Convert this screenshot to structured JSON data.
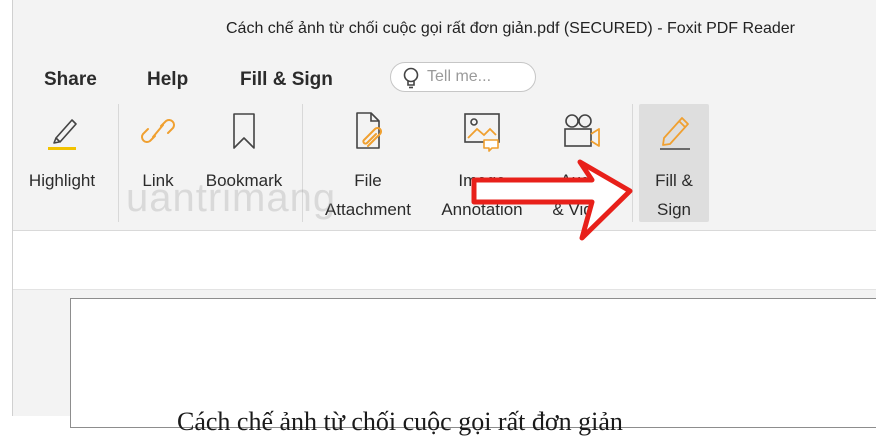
{
  "window": {
    "title": "Cách chế ảnh từ chối cuộc gọi rất đơn giản.pdf (SECURED) - Foxit PDF Reader"
  },
  "menu": {
    "tabs": [
      {
        "label": "Share"
      },
      {
        "label": "Help"
      },
      {
        "label": "Fill & Sign"
      }
    ],
    "tell_me": {
      "placeholder": "Tell me..."
    }
  },
  "toolbar": {
    "highlight": {
      "line1": "Highlight",
      "line2": "",
      "accent": "#f2c200"
    },
    "link": {
      "line1": "Link",
      "line2": "",
      "accent": "#f0a030"
    },
    "bookmark": {
      "line1": "Bookmark",
      "line2": ""
    },
    "file_attachment": {
      "line1": "File",
      "line2": "Attachment",
      "accent": "#f0a030"
    },
    "image_annotation": {
      "line1": "Image",
      "line2": "Annotation",
      "accent": "#f0a030"
    },
    "audio_video": {
      "line1": "Audio",
      "line2": "& Video",
      "accent": "#f0a030"
    },
    "fill_sign": {
      "line1": "Fill &",
      "line2": "Sign",
      "accent": "#f0a030"
    }
  },
  "icons": {
    "highlight": "highlighter-icon",
    "link": "link-icon",
    "bookmark": "bookmark-icon",
    "file_attachment": "file-attachment-icon",
    "image_annotation": "image-annotation-icon",
    "audio_video": "video-camera-icon",
    "fill_sign": "fill-sign-pen-icon",
    "tell_me": "lightbulb-icon"
  },
  "document": {
    "heading": "Cách chế ảnh từ chối cuộc gọi rất đơn giản"
  },
  "overlay": {
    "watermark": "uantrimang",
    "arrow_color": "#e8201a"
  }
}
